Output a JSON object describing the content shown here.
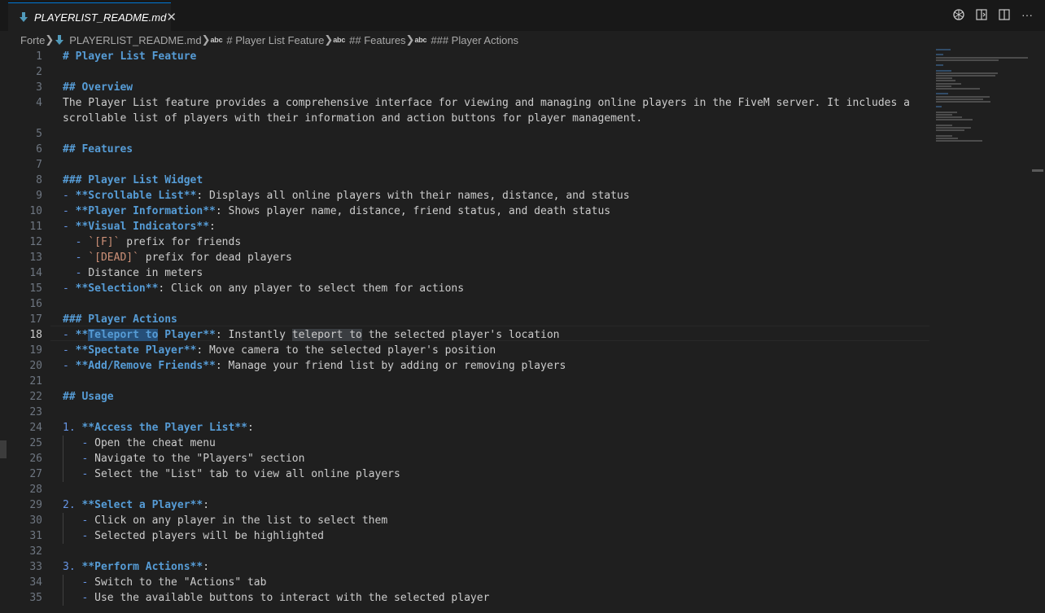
{
  "tab": {
    "title": "PLAYERLIST_README.md",
    "close": "✕",
    "icon": "markdown-arrow-icon"
  },
  "toolbar": {
    "icons": [
      "openai-icon",
      "open-preview-side-icon",
      "split-editor-icon",
      "more-actions-icon"
    ],
    "more": "···"
  },
  "breadcrumbs": [
    {
      "label": "Forte",
      "abc": false,
      "file": false
    },
    {
      "label": "PLAYERLIST_README.md",
      "abc": false,
      "file": true
    },
    {
      "label": "# Player List Feature",
      "abc": true,
      "file": false
    },
    {
      "label": "## Features",
      "abc": true,
      "file": false
    },
    {
      "label": "### Player Actions",
      "abc": true,
      "file": false
    }
  ],
  "abc_label": "abc",
  "active_line": 18,
  "lines": [
    [
      [
        "h",
        "# Player List Feature"
      ]
    ],
    [],
    [
      [
        "h",
        "## Overview"
      ]
    ],
    [
      [
        "t",
        "The Player List feature provides a comprehensive interface for viewing and managing online players in the FiveM server. It includes a"
      ]
    ],
    [
      [
        "t",
        "scrollable list of players with their information and action buttons for player management."
      ]
    ],
    [],
    [
      [
        "h",
        "## Features"
      ]
    ],
    [],
    [
      [
        "h",
        "### Player List Widget"
      ]
    ],
    [
      [
        "m",
        "- "
      ],
      [
        "b",
        "**Scrollable List**"
      ],
      [
        "t",
        ": Displays all online players with their names, distance, and status"
      ]
    ],
    [
      [
        "m",
        "- "
      ],
      [
        "b",
        "**Player Information**"
      ],
      [
        "t",
        ": Shows player name, distance, friend status, and death status"
      ]
    ],
    [
      [
        "m",
        "- "
      ],
      [
        "b",
        "**Visual Indicators**"
      ],
      [
        "t",
        ":"
      ]
    ],
    [
      [
        "t",
        "  "
      ],
      [
        "m",
        "- "
      ],
      [
        "cd",
        "`[F]`"
      ],
      [
        "t",
        " prefix for friends"
      ]
    ],
    [
      [
        "t",
        "  "
      ],
      [
        "m",
        "- "
      ],
      [
        "cd",
        "`[DEAD]`"
      ],
      [
        "t",
        " prefix for dead players"
      ]
    ],
    [
      [
        "t",
        "  "
      ],
      [
        "m",
        "- "
      ],
      [
        "t",
        "Distance in meters"
      ]
    ],
    [
      [
        "m",
        "- "
      ],
      [
        "b",
        "**Selection**"
      ],
      [
        "t",
        ": Click on any player to select them for actions"
      ]
    ],
    [],
    [
      [
        "h",
        "### Player Actions"
      ]
    ],
    [
      [
        "m",
        "- "
      ],
      [
        "b",
        "**"
      ],
      [
        "b hl1",
        "Teleport to"
      ],
      [
        "b",
        " Player**"
      ],
      [
        "t",
        ": Instantly "
      ],
      [
        "t hl2",
        "teleport to"
      ],
      [
        "t",
        " the selected player's location"
      ]
    ],
    [
      [
        "m",
        "- "
      ],
      [
        "b",
        "**Spectate Player**"
      ],
      [
        "t",
        ": Move camera to the selected player's position"
      ]
    ],
    [
      [
        "m",
        "- "
      ],
      [
        "b",
        "**Add/Remove Friends**"
      ],
      [
        "t",
        ": Manage your friend list by adding or removing players"
      ]
    ],
    [],
    [
      [
        "h",
        "## Usage"
      ]
    ],
    [],
    [
      [
        "m",
        "1. "
      ],
      [
        "b",
        "**Access the Player List**"
      ],
      [
        "t",
        ":"
      ]
    ],
    [
      [
        "t",
        "   "
      ],
      [
        "m",
        "- "
      ],
      [
        "t",
        "Open the cheat menu"
      ]
    ],
    [
      [
        "t",
        "   "
      ],
      [
        "m",
        "- "
      ],
      [
        "t",
        "Navigate to the \"Players\" section"
      ]
    ],
    [
      [
        "t",
        "   "
      ],
      [
        "m",
        "- "
      ],
      [
        "t",
        "Select the \"List\" tab to view all online players"
      ]
    ],
    [],
    [
      [
        "m",
        "2. "
      ],
      [
        "b",
        "**Select a Player**"
      ],
      [
        "t",
        ":"
      ]
    ],
    [
      [
        "t",
        "   "
      ],
      [
        "m",
        "- "
      ],
      [
        "t",
        "Click on any player in the list to select them"
      ]
    ],
    [
      [
        "t",
        "   "
      ],
      [
        "m",
        "- "
      ],
      [
        "t",
        "Selected players will be highlighted"
      ]
    ],
    [],
    [
      [
        "m",
        "3. "
      ],
      [
        "b",
        "**Perform Actions**"
      ],
      [
        "t",
        ":"
      ]
    ],
    [
      [
        "t",
        "   "
      ],
      [
        "m",
        "- "
      ],
      [
        "t",
        "Switch to the \"Actions\" tab"
      ]
    ],
    [
      [
        "t",
        "   "
      ],
      [
        "m",
        "- "
      ],
      [
        "t",
        "Use the available buttons to interact with the selected player"
      ]
    ]
  ],
  "line_numbers": [
    "1",
    "2",
    "3",
    "4",
    "",
    "5",
    "6",
    "7",
    "8",
    "9",
    "10",
    "11",
    "12",
    "13",
    "14",
    "15",
    "16",
    "17",
    "18",
    "19",
    "20",
    "21",
    "22",
    "23",
    "24",
    "25",
    "26",
    "27",
    "28",
    "29",
    "30",
    "31",
    "32",
    "33",
    "34",
    "35"
  ]
}
